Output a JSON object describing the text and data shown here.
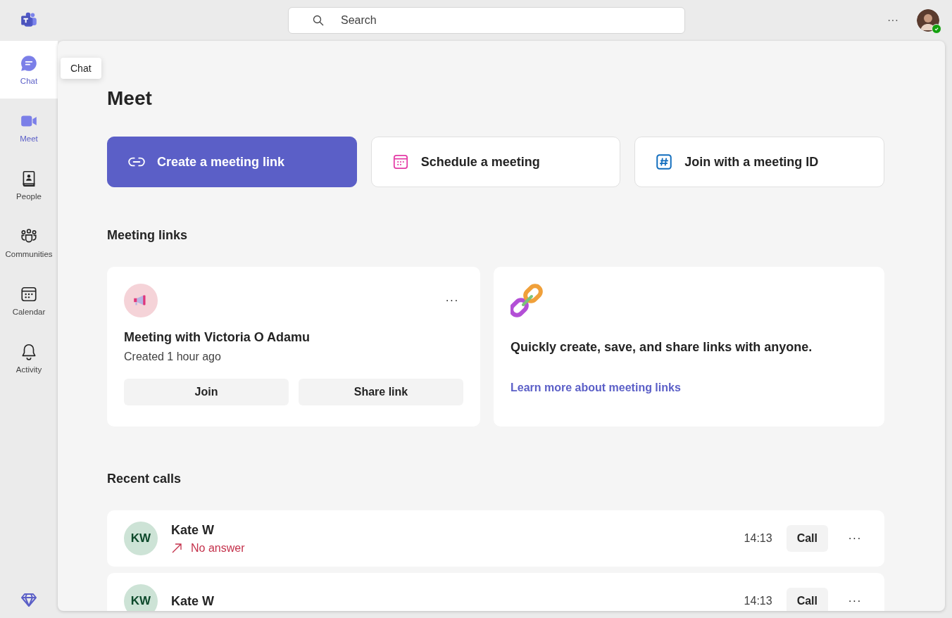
{
  "search": {
    "placeholder": "Search"
  },
  "top_bar": {
    "more": "···"
  },
  "rail": {
    "items": [
      {
        "label": "Chat",
        "kind": "chat",
        "selected": false,
        "hovered": true
      },
      {
        "label": "Meet",
        "kind": "meet",
        "selected": true,
        "hovered": false
      },
      {
        "label": "People",
        "kind": "people",
        "selected": false,
        "hovered": false
      },
      {
        "label": "Communities",
        "kind": "communities",
        "selected": false,
        "hovered": false
      },
      {
        "label": "Calendar",
        "kind": "calendar",
        "selected": false,
        "hovered": false
      },
      {
        "label": "Activity",
        "kind": "activity",
        "selected": false,
        "hovered": false
      }
    ]
  },
  "tooltip": {
    "text": "Chat"
  },
  "page": {
    "title": "Meet",
    "actions": [
      {
        "label": "Create a meeting link",
        "kind": "link",
        "primary": true
      },
      {
        "label": "Schedule a meeting",
        "kind": "calendar",
        "primary": false
      },
      {
        "label": "Join with a meeting ID",
        "kind": "hash",
        "primary": false
      }
    ],
    "meeting_links": {
      "heading": "Meeting links",
      "card": {
        "title": "Meeting with Victoria O Adamu",
        "subtitle": "Created 1 hour ago",
        "more": "···",
        "buttons": [
          "Join",
          "Share link"
        ]
      },
      "promo": {
        "text": "Quickly create, save, and share links with anyone.",
        "link": "Learn more about meeting links"
      }
    },
    "recent_calls": {
      "heading": "Recent calls",
      "rows": [
        {
          "initials": "KW",
          "name": "Kate W",
          "status": "No answer",
          "time": "14:13",
          "button": "Call",
          "more": "···"
        },
        {
          "initials": "KW",
          "name": "Kate W",
          "time": "14:13",
          "button": "Call",
          "more": "···"
        }
      ]
    }
  }
}
